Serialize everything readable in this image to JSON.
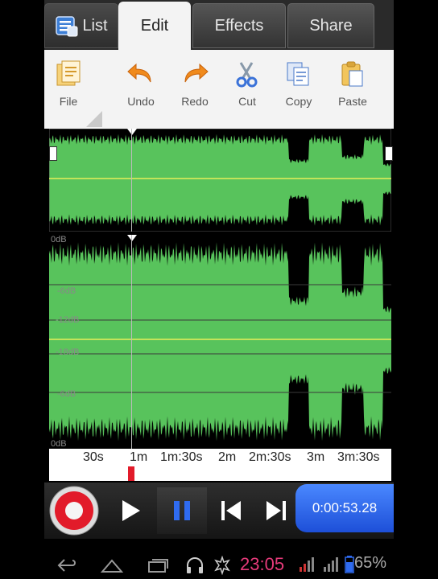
{
  "tabs": {
    "list": "List",
    "edit": "Edit",
    "effects": "Effects",
    "share": "Share"
  },
  "toolbar": {
    "file": "File",
    "undo": "Undo",
    "redo": "Redo",
    "cut": "Cut",
    "copy": "Copy",
    "paste": "Paste"
  },
  "waveform": {
    "db_labels": [
      "0dB",
      "-6dB",
      "-12dB",
      "-18dB",
      "-6dB",
      "0dB"
    ],
    "color": "#58c35c"
  },
  "timeline": {
    "ticks": [
      "30s",
      "1m",
      "1m:30s",
      "2m",
      "2m:30s",
      "3m",
      "3m:30s"
    ]
  },
  "transport": {
    "time": "0:00:53.28"
  },
  "status": {
    "clock": "23:05",
    "battery": "65%"
  },
  "colors": {
    "accent": "#2f6bf0",
    "record": "#e21b2a",
    "wave": "#58c35c"
  }
}
